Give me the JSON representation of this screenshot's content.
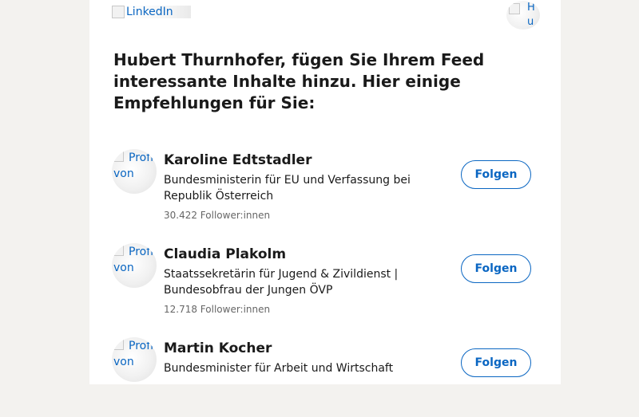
{
  "header": {
    "logo_alt": "LinkedIn",
    "avatar_alt": "Hube"
  },
  "headline": "Hubert Thurnhofer, fügen Sie Ihrem Feed interessante Inhalte hinzu. Hier einige Empfehlungen für Sie:",
  "recommendations": [
    {
      "avatar_alt": "Profilbild von",
      "name": "Karoline Edtstadler",
      "title": "Bundesministerin für EU und Verfassung bei Republik Österreich",
      "followers": "30.422 Follower:innen",
      "button": "Folgen"
    },
    {
      "avatar_alt": "Profilbild von",
      "name": "Claudia Plakolm",
      "title": "Staatssekretärin für Jugend & Zivildienst | Bundesobfrau der Jungen ÖVP",
      "followers": "12.718 Follower:innen",
      "button": "Folgen"
    },
    {
      "avatar_alt": "Profilbild von",
      "name": "Martin Kocher",
      "title": "Bundesminister für Arbeit und Wirtschaft",
      "button": "Folgen"
    }
  ],
  "colors": {
    "page_background": "#f3f2ef",
    "card_background": "#ffffff",
    "link_blue": "#0a66c2",
    "muted_text": "#666666"
  }
}
